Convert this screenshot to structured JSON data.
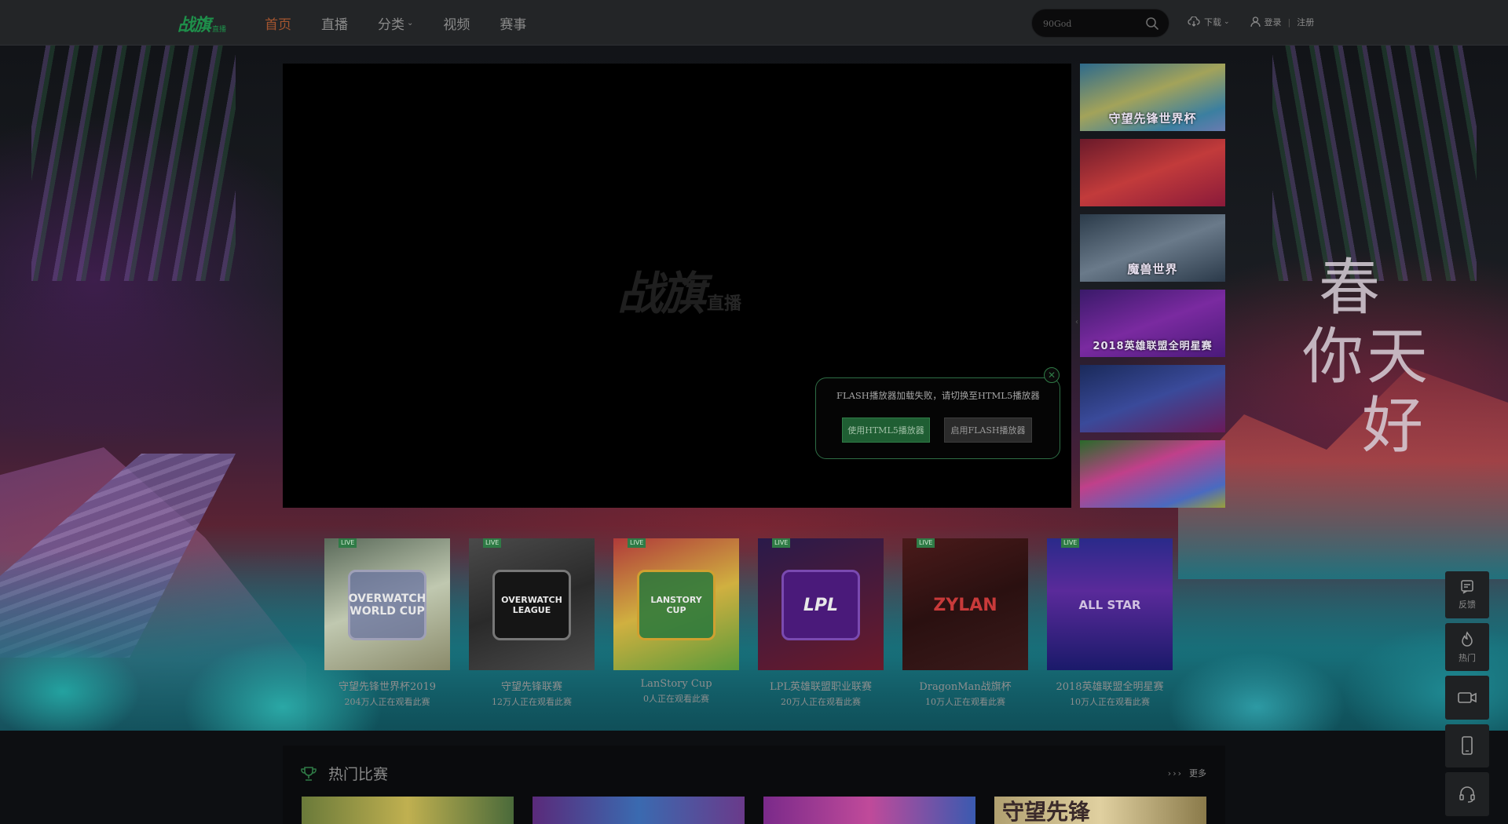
{
  "header": {
    "logo_main": "战旗",
    "logo_sub": "直播",
    "nav": [
      {
        "label": "首页",
        "active": true
      },
      {
        "label": "直播"
      },
      {
        "label": "分类",
        "has_dropdown": true
      },
      {
        "label": "视频"
      },
      {
        "label": "赛事"
      }
    ],
    "search": {
      "placeholder": "90God"
    },
    "links": {
      "download": "下载",
      "login": "登录",
      "register": "注册"
    }
  },
  "player": {
    "logo_main": "战旗",
    "logo_sub": "直播",
    "flash_dialog": {
      "message": "FLASH播放器加载失败，请切换至HTML5播放器",
      "html5_button": "使用HTML5播放器",
      "flash_button": "启用FLASH播放器"
    }
  },
  "carousel_thumbs": [
    {
      "caption": "守望先锋世界杯"
    },
    {
      "caption": ""
    },
    {
      "caption": "魔兽世界"
    },
    {
      "caption": "2018英雄联盟全明星赛"
    },
    {
      "caption": ""
    },
    {
      "caption": ""
    }
  ],
  "live_cards": [
    {
      "tag": "LIVE",
      "logo": "OVERWATCH WORLD CUP",
      "title": "守望先锋世界杯2019",
      "sub": "204万人正在观看此赛"
    },
    {
      "tag": "LIVE",
      "logo": "OVERWATCH LEAGUE",
      "title": "守望先锋联赛",
      "sub": "12万人正在观看此赛"
    },
    {
      "tag": "LIVE",
      "logo": "LANSTORY CUP",
      "title": "LanStory Cup",
      "sub": "0人正在观看此赛"
    },
    {
      "tag": "LIVE",
      "logo": "LPL",
      "title": "LPL英雄联盟职业联赛",
      "sub": "20万人正在观看此赛"
    },
    {
      "tag": "LIVE",
      "logo": "ZYLAN",
      "title": "DragonMan战旗杯",
      "sub": "10万人正在观看此赛"
    },
    {
      "tag": "LIVE",
      "logo": "ALL STAR",
      "title": "2018英雄联盟全明星赛",
      "sub": "10万人正在观看此赛"
    }
  ],
  "hot_matches": {
    "title": "热门比赛",
    "more": "更多",
    "thumb4_text": "守望先锋"
  },
  "side_toolbar": [
    {
      "icon": "feedback-icon",
      "label": "反馈"
    },
    {
      "icon": "flame-icon",
      "label": "热门"
    },
    {
      "icon": "video-icon",
      "label": ""
    },
    {
      "icon": "phone-icon",
      "label": ""
    },
    {
      "icon": "headset-icon",
      "label": ""
    }
  ],
  "backdrop": {
    "calligraphy_1": "春",
    "calligraphy_2": "你天",
    "calligraphy_3": "好"
  },
  "colors": {
    "accent_green": "#2f7b46",
    "nav_active": "#a3552f",
    "header_bg": "#232527"
  }
}
